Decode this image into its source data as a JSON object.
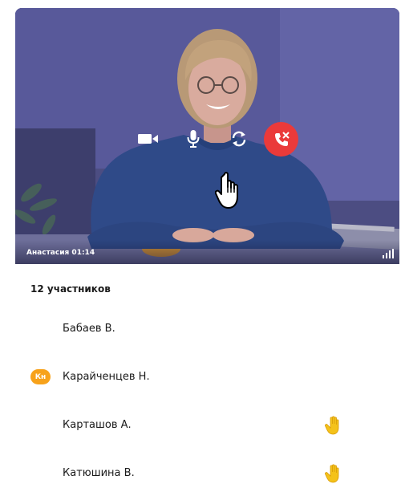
{
  "video": {
    "caption": "Анастасия 01:14",
    "hangup_color": "#ea3a3a",
    "controls": [
      "camera-icon",
      "microphone-icon",
      "switch-camera-icon",
      "hang-up-icon"
    ]
  },
  "participants": {
    "count_label": "12 участников",
    "avatar_color": "#f7a21b",
    "items": [
      {
        "name": "Бабаев В.",
        "avatar": "",
        "hand_raised": false
      },
      {
        "name": "Карайченцев Н.",
        "avatar": "Кн",
        "hand_raised": false
      },
      {
        "name": "Карташов А.",
        "avatar": "",
        "hand_raised": true
      },
      {
        "name": "Катюшина В.",
        "avatar": "",
        "hand_raised": true
      }
    ]
  }
}
